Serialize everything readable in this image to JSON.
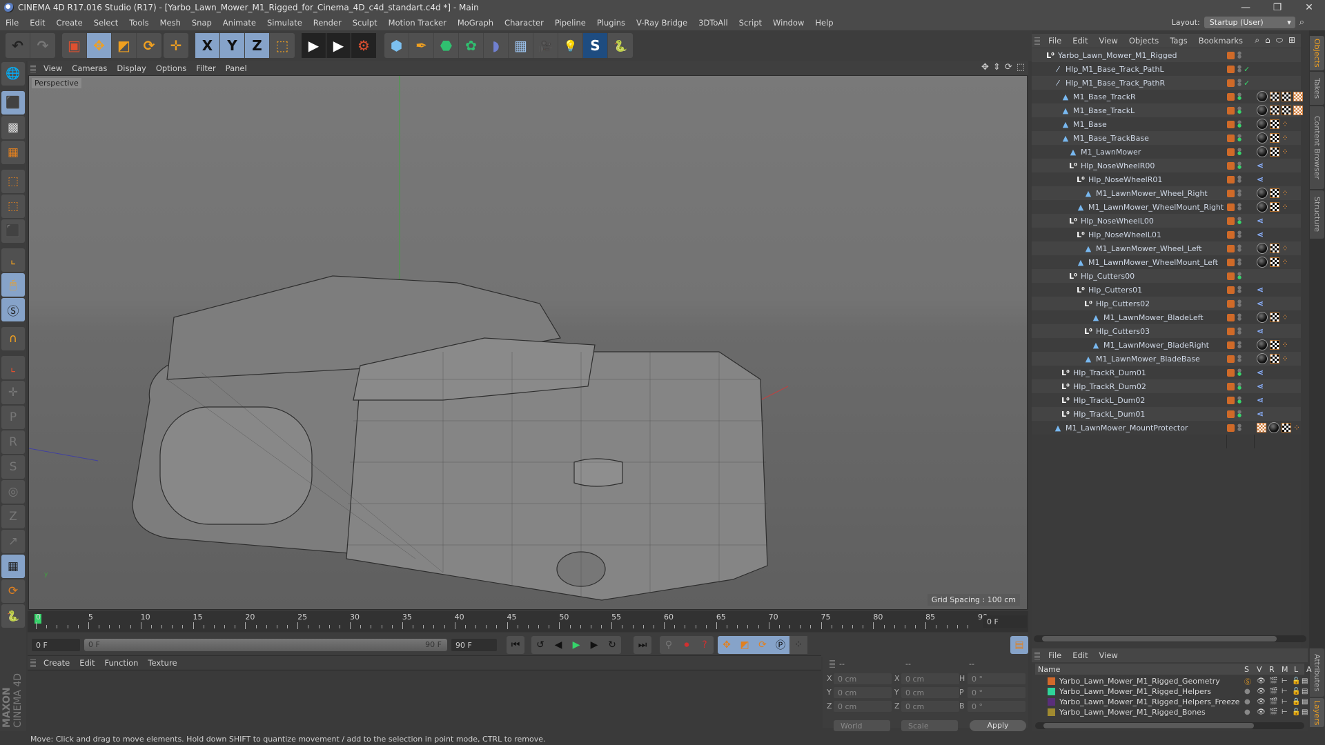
{
  "window": {
    "title": "CINEMA 4D R17.016 Studio (R17) - [Yarbo_Lawn_Mower_M1_Rigged_for_Cinema_4D_c4d_standart.c4d *] - Main",
    "minimize": "—",
    "restore": "❐",
    "close": "✕"
  },
  "menu": [
    "File",
    "Edit",
    "Create",
    "Select",
    "Tools",
    "Mesh",
    "Snap",
    "Animate",
    "Simulate",
    "Render",
    "Sculpt",
    "Motion Tracker",
    "MoGraph",
    "Character",
    "Pipeline",
    "Plugins",
    "V-Ray Bridge",
    "3DToAll",
    "Script",
    "Window",
    "Help"
  ],
  "layout": {
    "label": "Layout:",
    "value": "Startup (User)"
  },
  "toolbar": {
    "undo": "↶",
    "redo": "↷",
    "select": "▣",
    "move": "✥",
    "scale": "◩",
    "rotate": "⟳",
    "move2": "✛",
    "x": "X",
    "y": "Y",
    "z": "Z",
    "coord": "⬚",
    "render_view": "▶",
    "render_pic": "▶",
    "render_settings": "⚙",
    "cube": "⬢",
    "pen": "✒",
    "nurbs": "⬣",
    "mograph": "✿",
    "deformer": "◗",
    "floor": "▦",
    "camera": "🎥",
    "light": "💡",
    "sketch": "S",
    "python": "🐍"
  },
  "left_tools": [
    "globe-grid",
    "model",
    "texture",
    "workplane",
    "points",
    "edges",
    "polygons",
    "axis",
    "mouse",
    "snap-s",
    "magnet",
    "axis-lock",
    "move-plus",
    "move-p",
    "move-r",
    "move-psr",
    "move-target",
    "move-z",
    "move-arrow",
    "grid-lock",
    "grid-rotate",
    "python"
  ],
  "viewport": {
    "menu": [
      "View",
      "Cameras",
      "Display",
      "Options",
      "Filter",
      "Panel"
    ],
    "label": "Perspective",
    "grid_spacing": "Grid Spacing : 100 cm",
    "nav_icons": [
      "✥",
      "⇕",
      "⟳",
      "⬚"
    ]
  },
  "timeline": {
    "ticks": [
      "0",
      "5",
      "10",
      "15",
      "20",
      "25",
      "30",
      "35",
      "40",
      "45",
      "50",
      "55",
      "60",
      "65",
      "70",
      "75",
      "80",
      "85",
      "90"
    ],
    "current_frame": "0 F",
    "start_field": "0 F",
    "range_start": "0 F",
    "range_end": "90 F",
    "end_field": "90 F"
  },
  "material_menu": [
    "Create",
    "Edit",
    "Function",
    "Texture"
  ],
  "coords": {
    "headers": [
      "--",
      "--",
      "--"
    ],
    "rows": [
      {
        "l1": "X",
        "v1": "0 cm",
        "l2": "X",
        "v2": "0 cm",
        "l3": "H",
        "v3": "0 °"
      },
      {
        "l1": "Y",
        "v1": "0 cm",
        "l2": "Y",
        "v2": "0 cm",
        "l3": "P",
        "v3": "0 °"
      },
      {
        "l1": "Z",
        "v1": "0 cm",
        "l2": "Z",
        "v2": "0 cm",
        "l3": "B",
        "v3": "0 °"
      }
    ],
    "space": "World",
    "mode": "Scale",
    "apply": "Apply"
  },
  "status": "Move: Click and drag to move elements. Hold down SHIFT to quantize movement / add to the selection in point mode, CTRL to remove.",
  "brand": {
    "maxon": "MAXON",
    "product": "CINEMA 4D"
  },
  "object_manager": {
    "menu": [
      "File",
      "Edit",
      "View",
      "Objects",
      "Tags",
      "Bookmarks"
    ],
    "objects": [
      {
        "name": "Yarbo_Lawn_Mower_M1_Rigged",
        "type": "null",
        "depth": 0,
        "enabled": "",
        "tags": []
      },
      {
        "name": "Hlp_M1_Base_Track_PathL",
        "type": "spline",
        "depth": 1,
        "enabled": "check",
        "tags": []
      },
      {
        "name": "Hlp_M1_Base_Track_PathR",
        "type": "spline",
        "depth": 1,
        "enabled": "check",
        "tags": []
      },
      {
        "name": "M1_Base_TrackR",
        "type": "poly",
        "depth": 2,
        "enabled": "green",
        "tags": [
          "mat",
          "tex",
          "tex",
          "phong"
        ]
      },
      {
        "name": "M1_Base_TrackL",
        "type": "poly",
        "depth": 2,
        "enabled": "green",
        "tags": [
          "mat",
          "tex",
          "tex",
          "phong"
        ]
      },
      {
        "name": "M1_Base",
        "type": "poly",
        "depth": 2,
        "enabled": "green",
        "tags": [
          "mat",
          "tex",
          "bone"
        ]
      },
      {
        "name": "M1_Base_TrackBase",
        "type": "poly",
        "depth": 2,
        "enabled": "green",
        "tags": [
          "mat",
          "tex",
          "bone"
        ]
      },
      {
        "name": "M1_LawnMower",
        "type": "poly",
        "depth": 3,
        "enabled": "green",
        "tags": [
          "mat",
          "tex",
          "bone"
        ]
      },
      {
        "name": "Hlp_NoseWheelR00",
        "type": "null",
        "depth": 3,
        "enabled": "green",
        "tags": [
          "ik"
        ]
      },
      {
        "name": "Hlp_NoseWheelR01",
        "type": "null",
        "depth": 4,
        "enabled": "",
        "tags": [
          "ik"
        ]
      },
      {
        "name": "M1_LawnMower_Wheel_Right",
        "type": "poly",
        "depth": 5,
        "enabled": "",
        "tags": [
          "mat",
          "tex",
          "bone"
        ]
      },
      {
        "name": "M1_LawnMower_WheelMount_Right",
        "type": "poly",
        "depth": 4,
        "enabled": "",
        "tags": [
          "mat",
          "tex",
          "bone"
        ]
      },
      {
        "name": "Hlp_NoseWheelL00",
        "type": "null",
        "depth": 3,
        "enabled": "green",
        "tags": [
          "ik"
        ]
      },
      {
        "name": "Hlp_NoseWheelL01",
        "type": "null",
        "depth": 4,
        "enabled": "",
        "tags": [
          "ik"
        ]
      },
      {
        "name": "M1_LawnMower_Wheel_Left",
        "type": "poly",
        "depth": 5,
        "enabled": "",
        "tags": [
          "mat",
          "tex",
          "bone"
        ]
      },
      {
        "name": "M1_LawnMower_WheelMount_Left",
        "type": "poly",
        "depth": 4,
        "enabled": "",
        "tags": [
          "mat",
          "tex",
          "bone"
        ]
      },
      {
        "name": "Hlp_Cutters00",
        "type": "null",
        "depth": 3,
        "enabled": "green",
        "tags": []
      },
      {
        "name": "Hlp_Cutters01",
        "type": "null",
        "depth": 4,
        "enabled": "",
        "tags": [
          "ik"
        ]
      },
      {
        "name": "Hlp_Cutters02",
        "type": "null",
        "depth": 5,
        "enabled": "",
        "tags": [
          "ik"
        ]
      },
      {
        "name": "M1_LawnMower_BladeLeft",
        "type": "poly",
        "depth": 6,
        "enabled": "",
        "tags": [
          "mat",
          "tex",
          "bone"
        ]
      },
      {
        "name": "Hlp_Cutters03",
        "type": "null",
        "depth": 5,
        "enabled": "",
        "tags": [
          "ik"
        ]
      },
      {
        "name": "M1_LawnMower_BladeRight",
        "type": "poly",
        "depth": 6,
        "enabled": "",
        "tags": [
          "mat",
          "tex",
          "bone"
        ]
      },
      {
        "name": "M1_LawnMower_BladeBase",
        "type": "poly",
        "depth": 5,
        "enabled": "",
        "tags": [
          "mat",
          "tex",
          "bone"
        ]
      },
      {
        "name": "Hlp_TrackR_Dum01",
        "type": "null",
        "depth": 2,
        "enabled": "green",
        "tags": [
          "ik"
        ]
      },
      {
        "name": "Hlp_TrackR_Dum02",
        "type": "null",
        "depth": 2,
        "enabled": "green",
        "tags": [
          "ik"
        ]
      },
      {
        "name": "Hlp_TrackL_Dum02",
        "type": "null",
        "depth": 2,
        "enabled": "green",
        "tags": [
          "ik"
        ]
      },
      {
        "name": "Hlp_TrackL_Dum01",
        "type": "null",
        "depth": 2,
        "enabled": "green",
        "tags": [
          "ik"
        ]
      },
      {
        "name": "M1_LawnMower_MountProtector",
        "type": "poly",
        "depth": 1,
        "enabled": "",
        "tags": [
          "phong",
          "mat",
          "tex",
          "bone"
        ]
      }
    ]
  },
  "side_tabs": [
    "Objects",
    "Takes",
    "Content Browser",
    "Structure"
  ],
  "side_tabs_bottom": [
    "Attributes",
    "Layers"
  ],
  "layer_manager": {
    "menu": [
      "File",
      "Edit",
      "View"
    ],
    "columns": [
      "Name",
      "S",
      "V",
      "R",
      "M",
      "L",
      "A"
    ],
    "layers": [
      {
        "name": "Yarbo_Lawn_Mower_M1_Rigged_Geometry",
        "color": "#d2692b",
        "solo": true,
        "locked": false
      },
      {
        "name": "Yarbo_Lawn_Mower_M1_Rigged_Helpers",
        "color": "#2fd49a",
        "solo": false,
        "locked": false
      },
      {
        "name": "Yarbo_Lawn_Mower_M1_Rigged_Helpers_Freeze",
        "color": "#5a2e7a",
        "solo": false,
        "locked": true
      },
      {
        "name": "Yarbo_Lawn_Mower_M1_Rigged_Bones",
        "color": "#a08a30",
        "solo": false,
        "locked": false
      }
    ]
  }
}
